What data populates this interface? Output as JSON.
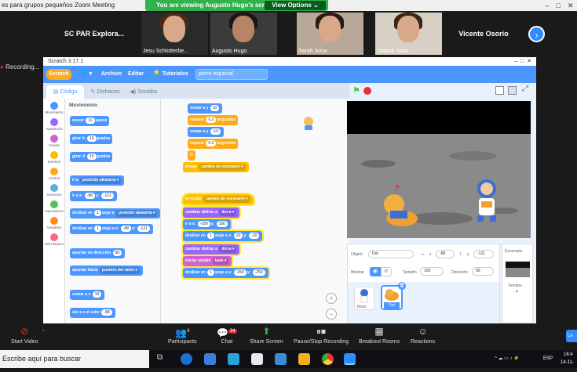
{
  "zoom_top": {
    "title": "es para grupos pequeños   Zoom Meeting",
    "window_controls": [
      "–",
      "□",
      "✕"
    ]
  },
  "share_banner": {
    "label": "You are viewing Augusto Hugo's screen",
    "view_options": "View Options ⌄"
  },
  "gallery": {
    "left_text": "SC PAR Explora...",
    "participants": [
      {
        "name": "Jesu Schlotterbe...",
        "hair": "#4a2a15",
        "bg": "#c9b8a0"
      },
      {
        "name": "Augusto Hugo",
        "hair": "#1c1410",
        "bg": "#3b3b3b"
      },
      {
        "name": "Sarah Sosa",
        "hair": "#2a1a10",
        "bg": "#b8a89a"
      },
      {
        "name": "Jadash Sosa",
        "hair": "#3a2418",
        "bg": "#d8d0c4"
      }
    ],
    "right_text": "Vicente Osorio",
    "next_icon": "›"
  },
  "recording": "Recording...",
  "scratch": {
    "window_title": "Scratch 3.17.1",
    "logo": "Scratch",
    "menu": {
      "globe": "🌐 ▾",
      "archivo": "Archivo",
      "editar": "Editar",
      "tutoriales": "Tutoriales",
      "project_name": "perro espacial"
    },
    "tabs": [
      "Código",
      "Disfraces",
      "Sonidos"
    ],
    "categories": [
      {
        "label": "Movimiento",
        "color": "#4c97ff"
      },
      {
        "label": "Apariencia",
        "color": "#9966ff"
      },
      {
        "label": "Sonido",
        "color": "#cf63cf"
      },
      {
        "label": "Eventos",
        "color": "#ffbf00"
      },
      {
        "label": "Control",
        "color": "#ffab19"
      },
      {
        "label": "Sensores",
        "color": "#5cb1d6"
      },
      {
        "label": "Operadores",
        "color": "#59c059"
      },
      {
        "label": "Variables",
        "color": "#ff8c1a"
      },
      {
        "label": "Mis bloques",
        "color": "#ff6680"
      }
    ],
    "palette": {
      "heading": "Movimiento",
      "blocks": [
        {
          "parts": [
            "mover",
            "[10]",
            "pasos"
          ]
        },
        {
          "parts": [
            "girar ↻",
            "[15]",
            "grados"
          ]
        },
        {
          "parts": [
            "girar ↺",
            "[15]",
            "grados"
          ]
        },
        {
          "parts": [
            "ir a",
            "{posición aleatoria ▾}"
          ]
        },
        {
          "parts": [
            "ir a x:",
            "[-88]",
            "y:",
            "[-121]"
          ]
        },
        {
          "parts": [
            "deslizar en",
            "[1]",
            "segs a",
            "{posición aleatoria ▾}"
          ]
        },
        {
          "parts": [
            "deslizar en",
            "[1]",
            "segs a x:",
            "[-88]",
            "y:",
            "[-121]"
          ]
        },
        {
          "parts": [
            "apuntar en dirección",
            "[90]"
          ]
        },
        {
          "parts": [
            "apuntar hacia",
            "{puntero del ratón ▾}"
          ]
        },
        {
          "parts": [
            "sumar a x",
            "[10]"
          ]
        },
        {
          "parts": [
            "dar a x el valor",
            "[-88]"
          ]
        }
      ]
    },
    "code": {
      "top_stack": [
        {
          "cls": "mot",
          "parts": [
            "sumar a y",
            "[10]"
          ]
        },
        {
          "cls": "ctl",
          "parts": [
            "esperar",
            "[0.2]",
            "segundos"
          ]
        },
        {
          "cls": "mot",
          "parts": [
            "sumar a y",
            "[-10]"
          ]
        },
        {
          "cls": "ctl",
          "parts": [
            "esperar",
            "[0.2]",
            "segundos"
          ]
        },
        {
          "cls": "ctl",
          "parts": [
            "",
            "↻"
          ]
        },
        {
          "cls": "evt",
          "parts": [
            "enviar",
            "{cambio de escenario ▾}"
          ]
        }
      ],
      "bottom_stack": [
        {
          "cls": "evt",
          "parts": [
            "al recibir",
            "{cambio de escenario ▾}"
          ]
        },
        {
          "cls": "lks",
          "parts": [
            "cambiar disfraz a",
            "{dot-a ▾}"
          ]
        },
        {
          "cls": "mot",
          "parts": [
            "ir a x:",
            "[-180]",
            "y:",
            "[100]"
          ]
        },
        {
          "cls": "mot",
          "parts": [
            "deslizar en",
            "[1]",
            "segs a x:",
            "[20]",
            "y:",
            "[-20]"
          ]
        },
        {
          "cls": "lks",
          "parts": [
            "cambiar disfraz a",
            "{dot-a ▾}"
          ]
        },
        {
          "cls": "snd",
          "parts": [
            "iniciar sonido",
            "{bark ▾}"
          ]
        },
        {
          "cls": "mot",
          "parts": [
            "deslizar en",
            "[1]",
            "segs a x:",
            "[-250]",
            "y:",
            "[-250]"
          ]
        }
      ],
      "zoom_in": "+",
      "zoom_out": "−"
    },
    "sprite_info": {
      "objeto_label": "Objeto",
      "objeto_value": "Dot",
      "x_label": "x",
      "x_value": "-88",
      "y_label": "y",
      "y_value": "-121",
      "mostrar_label": "Mostrar",
      "tamano_label": "Tamaño",
      "tamano_value": "100",
      "direccion_label": "Dirección",
      "direccion_value": "90",
      "sprites": [
        "Kiran",
        "Dot"
      ]
    },
    "stage_pane": {
      "title": "Escenario",
      "fondos_label": "Fondos",
      "fondos_count": "4"
    }
  },
  "toolbar": {
    "start_video": "Start Video",
    "participants": "Participants",
    "participants_count": "8",
    "chat": "Chat",
    "chat_badge": "34",
    "share_screen": "Share Screen",
    "pause_recording": "Pause/Stop Recording",
    "breakout_rooms": "Breakout Rooms",
    "reactions": "Reactions",
    "leave": "Le"
  },
  "taskbar": {
    "search_placeholder": "Escribe aquí para buscar",
    "lang": "ESP",
    "time": "16:4",
    "date": "14-11-"
  }
}
